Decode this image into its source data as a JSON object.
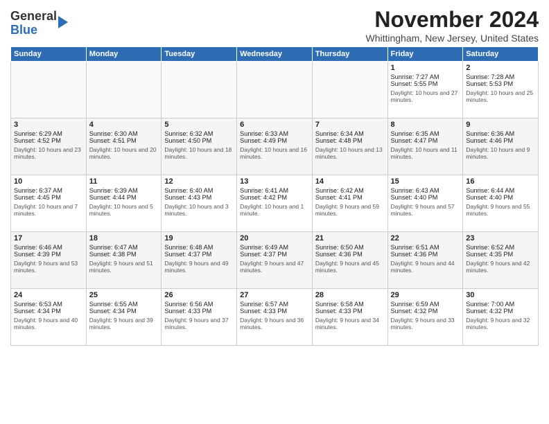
{
  "header": {
    "logo_line1": "General",
    "logo_line2": "Blue",
    "month": "November 2024",
    "location": "Whittingham, New Jersey, United States"
  },
  "days_of_week": [
    "Sunday",
    "Monday",
    "Tuesday",
    "Wednesday",
    "Thursday",
    "Friday",
    "Saturday"
  ],
  "weeks": [
    [
      {
        "day": "",
        "sunrise": "",
        "sunset": "",
        "daylight": ""
      },
      {
        "day": "",
        "sunrise": "",
        "sunset": "",
        "daylight": ""
      },
      {
        "day": "",
        "sunrise": "",
        "sunset": "",
        "daylight": ""
      },
      {
        "day": "",
        "sunrise": "",
        "sunset": "",
        "daylight": ""
      },
      {
        "day": "",
        "sunrise": "",
        "sunset": "",
        "daylight": ""
      },
      {
        "day": "1",
        "sunrise": "Sunrise: 7:27 AM",
        "sunset": "Sunset: 5:55 PM",
        "daylight": "Daylight: 10 hours and 27 minutes."
      },
      {
        "day": "2",
        "sunrise": "Sunrise: 7:28 AM",
        "sunset": "Sunset: 5:53 PM",
        "daylight": "Daylight: 10 hours and 25 minutes."
      }
    ],
    [
      {
        "day": "3",
        "sunrise": "Sunrise: 6:29 AM",
        "sunset": "Sunset: 4:52 PM",
        "daylight": "Daylight: 10 hours and 23 minutes."
      },
      {
        "day": "4",
        "sunrise": "Sunrise: 6:30 AM",
        "sunset": "Sunset: 4:51 PM",
        "daylight": "Daylight: 10 hours and 20 minutes."
      },
      {
        "day": "5",
        "sunrise": "Sunrise: 6:32 AM",
        "sunset": "Sunset: 4:50 PM",
        "daylight": "Daylight: 10 hours and 18 minutes."
      },
      {
        "day": "6",
        "sunrise": "Sunrise: 6:33 AM",
        "sunset": "Sunset: 4:49 PM",
        "daylight": "Daylight: 10 hours and 16 minutes."
      },
      {
        "day": "7",
        "sunrise": "Sunrise: 6:34 AM",
        "sunset": "Sunset: 4:48 PM",
        "daylight": "Daylight: 10 hours and 13 minutes."
      },
      {
        "day": "8",
        "sunrise": "Sunrise: 6:35 AM",
        "sunset": "Sunset: 4:47 PM",
        "daylight": "Daylight: 10 hours and 11 minutes."
      },
      {
        "day": "9",
        "sunrise": "Sunrise: 6:36 AM",
        "sunset": "Sunset: 4:46 PM",
        "daylight": "Daylight: 10 hours and 9 minutes."
      }
    ],
    [
      {
        "day": "10",
        "sunrise": "Sunrise: 6:37 AM",
        "sunset": "Sunset: 4:45 PM",
        "daylight": "Daylight: 10 hours and 7 minutes."
      },
      {
        "day": "11",
        "sunrise": "Sunrise: 6:39 AM",
        "sunset": "Sunset: 4:44 PM",
        "daylight": "Daylight: 10 hours and 5 minutes."
      },
      {
        "day": "12",
        "sunrise": "Sunrise: 6:40 AM",
        "sunset": "Sunset: 4:43 PM",
        "daylight": "Daylight: 10 hours and 3 minutes."
      },
      {
        "day": "13",
        "sunrise": "Sunrise: 6:41 AM",
        "sunset": "Sunset: 4:42 PM",
        "daylight": "Daylight: 10 hours and 1 minute."
      },
      {
        "day": "14",
        "sunrise": "Sunrise: 6:42 AM",
        "sunset": "Sunset: 4:41 PM",
        "daylight": "Daylight: 9 hours and 59 minutes."
      },
      {
        "day": "15",
        "sunrise": "Sunrise: 6:43 AM",
        "sunset": "Sunset: 4:40 PM",
        "daylight": "Daylight: 9 hours and 57 minutes."
      },
      {
        "day": "16",
        "sunrise": "Sunrise: 6:44 AM",
        "sunset": "Sunset: 4:40 PM",
        "daylight": "Daylight: 9 hours and 55 minutes."
      }
    ],
    [
      {
        "day": "17",
        "sunrise": "Sunrise: 6:46 AM",
        "sunset": "Sunset: 4:39 PM",
        "daylight": "Daylight: 9 hours and 53 minutes."
      },
      {
        "day": "18",
        "sunrise": "Sunrise: 6:47 AM",
        "sunset": "Sunset: 4:38 PM",
        "daylight": "Daylight: 9 hours and 51 minutes."
      },
      {
        "day": "19",
        "sunrise": "Sunrise: 6:48 AM",
        "sunset": "Sunset: 4:37 PM",
        "daylight": "Daylight: 9 hours and 49 minutes."
      },
      {
        "day": "20",
        "sunrise": "Sunrise: 6:49 AM",
        "sunset": "Sunset: 4:37 PM",
        "daylight": "Daylight: 9 hours and 47 minutes."
      },
      {
        "day": "21",
        "sunrise": "Sunrise: 6:50 AM",
        "sunset": "Sunset: 4:36 PM",
        "daylight": "Daylight: 9 hours and 45 minutes."
      },
      {
        "day": "22",
        "sunrise": "Sunrise: 6:51 AM",
        "sunset": "Sunset: 4:36 PM",
        "daylight": "Daylight: 9 hours and 44 minutes."
      },
      {
        "day": "23",
        "sunrise": "Sunrise: 6:52 AM",
        "sunset": "Sunset: 4:35 PM",
        "daylight": "Daylight: 9 hours and 42 minutes."
      }
    ],
    [
      {
        "day": "24",
        "sunrise": "Sunrise: 6:53 AM",
        "sunset": "Sunset: 4:34 PM",
        "daylight": "Daylight: 9 hours and 40 minutes."
      },
      {
        "day": "25",
        "sunrise": "Sunrise: 6:55 AM",
        "sunset": "Sunset: 4:34 PM",
        "daylight": "Daylight: 9 hours and 39 minutes."
      },
      {
        "day": "26",
        "sunrise": "Sunrise: 6:56 AM",
        "sunset": "Sunset: 4:33 PM",
        "daylight": "Daylight: 9 hours and 37 minutes."
      },
      {
        "day": "27",
        "sunrise": "Sunrise: 6:57 AM",
        "sunset": "Sunset: 4:33 PM",
        "daylight": "Daylight: 9 hours and 36 minutes."
      },
      {
        "day": "28",
        "sunrise": "Sunrise: 6:58 AM",
        "sunset": "Sunset: 4:33 PM",
        "daylight": "Daylight: 9 hours and 34 minutes."
      },
      {
        "day": "29",
        "sunrise": "Sunrise: 6:59 AM",
        "sunset": "Sunset: 4:32 PM",
        "daylight": "Daylight: 9 hours and 33 minutes."
      },
      {
        "day": "30",
        "sunrise": "Sunrise: 7:00 AM",
        "sunset": "Sunset: 4:32 PM",
        "daylight": "Daylight: 9 hours and 32 minutes."
      }
    ]
  ]
}
